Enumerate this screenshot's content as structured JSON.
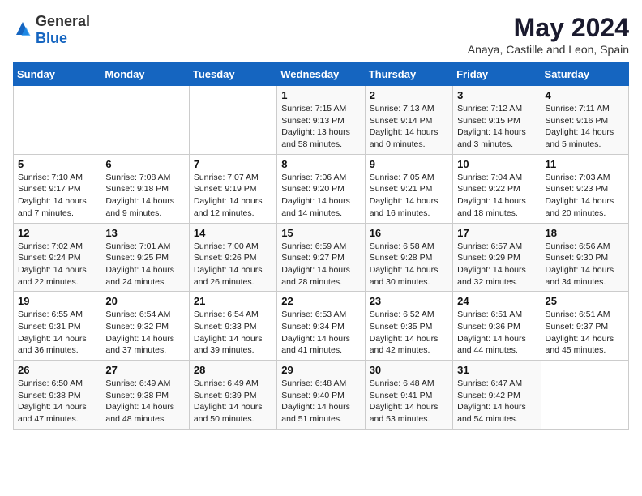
{
  "header": {
    "logo_general": "General",
    "logo_blue": "Blue",
    "title": "May 2024",
    "subtitle": "Anaya, Castille and Leon, Spain"
  },
  "weekdays": [
    "Sunday",
    "Monday",
    "Tuesday",
    "Wednesday",
    "Thursday",
    "Friday",
    "Saturday"
  ],
  "weeks": [
    [
      {
        "day": "",
        "info": ""
      },
      {
        "day": "",
        "info": ""
      },
      {
        "day": "",
        "info": ""
      },
      {
        "day": "1",
        "info": "Sunrise: 7:15 AM\nSunset: 9:13 PM\nDaylight: 13 hours\nand 58 minutes."
      },
      {
        "day": "2",
        "info": "Sunrise: 7:13 AM\nSunset: 9:14 PM\nDaylight: 14 hours\nand 0 minutes."
      },
      {
        "day": "3",
        "info": "Sunrise: 7:12 AM\nSunset: 9:15 PM\nDaylight: 14 hours\nand 3 minutes."
      },
      {
        "day": "4",
        "info": "Sunrise: 7:11 AM\nSunset: 9:16 PM\nDaylight: 14 hours\nand 5 minutes."
      }
    ],
    [
      {
        "day": "5",
        "info": "Sunrise: 7:10 AM\nSunset: 9:17 PM\nDaylight: 14 hours\nand 7 minutes."
      },
      {
        "day": "6",
        "info": "Sunrise: 7:08 AM\nSunset: 9:18 PM\nDaylight: 14 hours\nand 9 minutes."
      },
      {
        "day": "7",
        "info": "Sunrise: 7:07 AM\nSunset: 9:19 PM\nDaylight: 14 hours\nand 12 minutes."
      },
      {
        "day": "8",
        "info": "Sunrise: 7:06 AM\nSunset: 9:20 PM\nDaylight: 14 hours\nand 14 minutes."
      },
      {
        "day": "9",
        "info": "Sunrise: 7:05 AM\nSunset: 9:21 PM\nDaylight: 14 hours\nand 16 minutes."
      },
      {
        "day": "10",
        "info": "Sunrise: 7:04 AM\nSunset: 9:22 PM\nDaylight: 14 hours\nand 18 minutes."
      },
      {
        "day": "11",
        "info": "Sunrise: 7:03 AM\nSunset: 9:23 PM\nDaylight: 14 hours\nand 20 minutes."
      }
    ],
    [
      {
        "day": "12",
        "info": "Sunrise: 7:02 AM\nSunset: 9:24 PM\nDaylight: 14 hours\nand 22 minutes."
      },
      {
        "day": "13",
        "info": "Sunrise: 7:01 AM\nSunset: 9:25 PM\nDaylight: 14 hours\nand 24 minutes."
      },
      {
        "day": "14",
        "info": "Sunrise: 7:00 AM\nSunset: 9:26 PM\nDaylight: 14 hours\nand 26 minutes."
      },
      {
        "day": "15",
        "info": "Sunrise: 6:59 AM\nSunset: 9:27 PM\nDaylight: 14 hours\nand 28 minutes."
      },
      {
        "day": "16",
        "info": "Sunrise: 6:58 AM\nSunset: 9:28 PM\nDaylight: 14 hours\nand 30 minutes."
      },
      {
        "day": "17",
        "info": "Sunrise: 6:57 AM\nSunset: 9:29 PM\nDaylight: 14 hours\nand 32 minutes."
      },
      {
        "day": "18",
        "info": "Sunrise: 6:56 AM\nSunset: 9:30 PM\nDaylight: 14 hours\nand 34 minutes."
      }
    ],
    [
      {
        "day": "19",
        "info": "Sunrise: 6:55 AM\nSunset: 9:31 PM\nDaylight: 14 hours\nand 36 minutes."
      },
      {
        "day": "20",
        "info": "Sunrise: 6:54 AM\nSunset: 9:32 PM\nDaylight: 14 hours\nand 37 minutes."
      },
      {
        "day": "21",
        "info": "Sunrise: 6:54 AM\nSunset: 9:33 PM\nDaylight: 14 hours\nand 39 minutes."
      },
      {
        "day": "22",
        "info": "Sunrise: 6:53 AM\nSunset: 9:34 PM\nDaylight: 14 hours\nand 41 minutes."
      },
      {
        "day": "23",
        "info": "Sunrise: 6:52 AM\nSunset: 9:35 PM\nDaylight: 14 hours\nand 42 minutes."
      },
      {
        "day": "24",
        "info": "Sunrise: 6:51 AM\nSunset: 9:36 PM\nDaylight: 14 hours\nand 44 minutes."
      },
      {
        "day": "25",
        "info": "Sunrise: 6:51 AM\nSunset: 9:37 PM\nDaylight: 14 hours\nand 45 minutes."
      }
    ],
    [
      {
        "day": "26",
        "info": "Sunrise: 6:50 AM\nSunset: 9:38 PM\nDaylight: 14 hours\nand 47 minutes."
      },
      {
        "day": "27",
        "info": "Sunrise: 6:49 AM\nSunset: 9:38 PM\nDaylight: 14 hours\nand 48 minutes."
      },
      {
        "day": "28",
        "info": "Sunrise: 6:49 AM\nSunset: 9:39 PM\nDaylight: 14 hours\nand 50 minutes."
      },
      {
        "day": "29",
        "info": "Sunrise: 6:48 AM\nSunset: 9:40 PM\nDaylight: 14 hours\nand 51 minutes."
      },
      {
        "day": "30",
        "info": "Sunrise: 6:48 AM\nSunset: 9:41 PM\nDaylight: 14 hours\nand 53 minutes."
      },
      {
        "day": "31",
        "info": "Sunrise: 6:47 AM\nSunset: 9:42 PM\nDaylight: 14 hours\nand 54 minutes."
      },
      {
        "day": "",
        "info": ""
      }
    ]
  ]
}
